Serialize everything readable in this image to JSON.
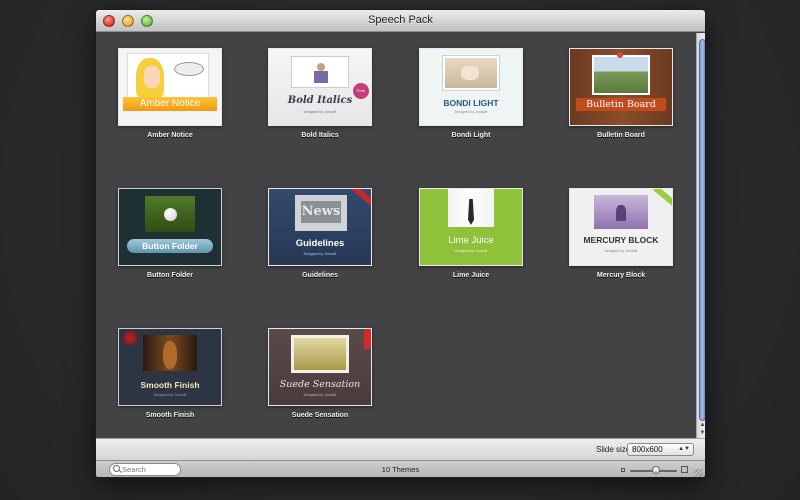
{
  "window": {
    "title": "Speech Pack"
  },
  "themes": [
    {
      "name": "Amber Notice",
      "thumb_text": "Amber Notice",
      "sub": ""
    },
    {
      "name": "Bold Italics",
      "thumb_text": "Bold Italics",
      "sub": "Designed by Jumsoft",
      "badge": "Free"
    },
    {
      "name": "Bondi Light",
      "thumb_text": "BONDI LIGHT",
      "sub": "Designed by Jumsoft"
    },
    {
      "name": "Bulletin Board",
      "thumb_text": "Bulletin Board",
      "sub": ""
    },
    {
      "name": "Button Folder",
      "thumb_text": "Button Folder",
      "sub": ""
    },
    {
      "name": "Guidelines",
      "thumb_text": "Guidelines",
      "sub": "Designed by Jumsoft",
      "collage": "News"
    },
    {
      "name": "Lime Juice",
      "thumb_text": "Lime Juice",
      "sub": "Designed by Jumsoft"
    },
    {
      "name": "Mercury Block",
      "thumb_text": "MERCURY BLOCK",
      "sub": "Designed by Jumsoft"
    },
    {
      "name": "Smooth Finish",
      "thumb_text": "Smooth Finish",
      "sub": "Designed by Jumsoft"
    },
    {
      "name": "Suede Sensation",
      "thumb_text": "Suede Sensation",
      "sub": "Designed by Jumsoft"
    }
  ],
  "bottom": {
    "slide_size_label": "Slide size:",
    "slide_size_value": "800x600"
  },
  "status": {
    "search_placeholder": "Search",
    "count": "10 Themes"
  },
  "zoom": {
    "level": 0.55
  },
  "scroll": {
    "position": 0
  },
  "colors": {
    "window_bg": "#434346",
    "label": "#f2f2f2",
    "scroll_thumb": "#8aa3d8"
  }
}
